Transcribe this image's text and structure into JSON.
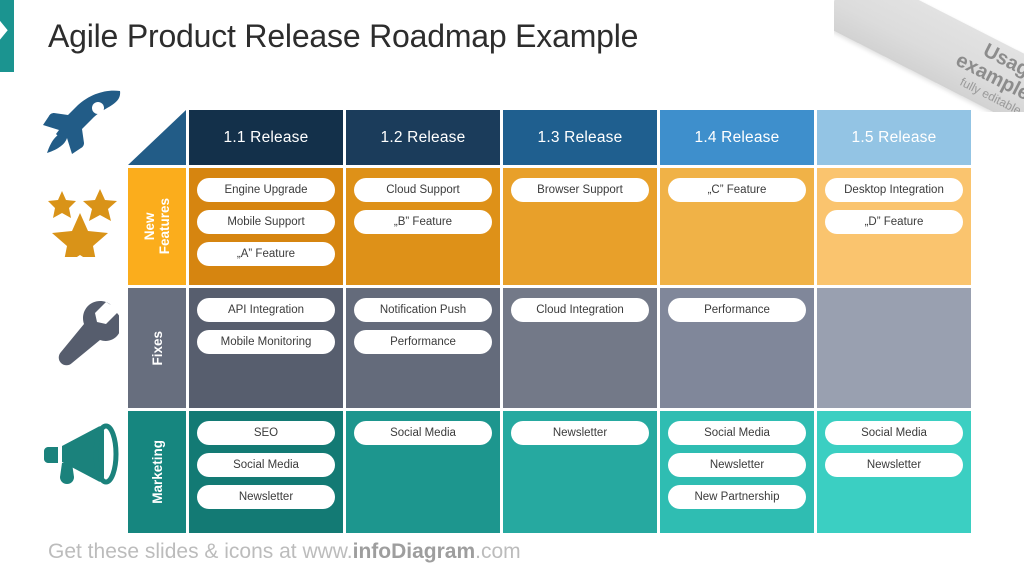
{
  "title": "Agile Product Release Roadmap Example",
  "ribbon": {
    "line1": "Usage",
    "line2": "example",
    "line3": "fully editable"
  },
  "footer": {
    "prefix": "Get these slides & icons at www.",
    "brand": "infoDiagram",
    "suffix": ".com"
  },
  "icons": {
    "rocket": "rocket-icon",
    "stars": "stars-icon",
    "wrench": "wrench-icon",
    "megaphone": "megaphone-icon"
  },
  "colors": {
    "accent_teal": "#1B9490",
    "header_1": "#13304A",
    "header_2": "#1B3C5B",
    "header_3": "#1F5F8F",
    "header_4": "#3E8FCC",
    "header_5": "#93C4E4",
    "row_features": "#FBAD1C",
    "row_fixes": "#676E7E",
    "row_marketing": "#16867F",
    "corner_triangle": "#225C87"
  },
  "table": {
    "columns": [
      "1.1 Release",
      "1.2 Release",
      "1.3 Release",
      "1.4 Release",
      "1.5 Release"
    ],
    "rows": [
      {
        "label": "New\nFeatures",
        "cells": [
          [
            "Engine Upgrade",
            "Mobile Support",
            "„A” Feature"
          ],
          [
            "Cloud Support",
            "„B” Feature"
          ],
          [
            "Browser Support"
          ],
          [
            "„C” Feature"
          ],
          [
            "Desktop Integration",
            "„D” Feature"
          ]
        ]
      },
      {
        "label": "Fixes",
        "cells": [
          [
            "API Integration",
            "Mobile Monitoring"
          ],
          [
            "Notification Push",
            "Performance"
          ],
          [
            "Cloud Integration"
          ],
          [
            "Performance"
          ],
          []
        ]
      },
      {
        "label": "Marketing",
        "cells": [
          [
            "SEO",
            "Social Media",
            "Newsletter"
          ],
          [
            "Social Media"
          ],
          [
            "Newsletter"
          ],
          [
            "Social Media",
            "Newsletter",
            "New Partnership"
          ],
          [
            "Social Media",
            "Newsletter"
          ]
        ]
      }
    ]
  }
}
